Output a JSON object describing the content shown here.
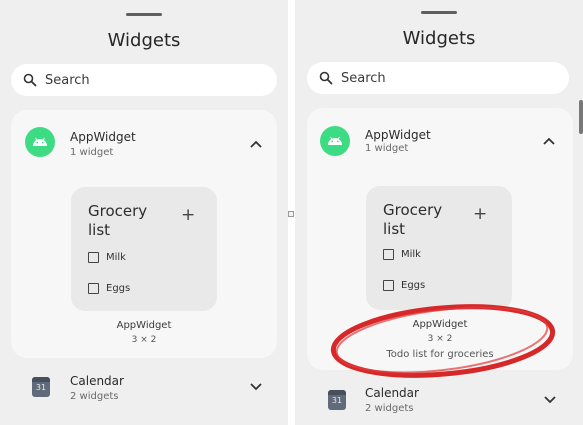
{
  "header": {
    "title": "Widgets"
  },
  "search": {
    "placeholder": "Search",
    "icon": "search-icon"
  },
  "app_widget": {
    "name": "AppWidget",
    "count": "1 widget",
    "icon_color": "#3ddc84"
  },
  "preview": {
    "title": "Grocery list",
    "add_symbol": "+",
    "items": [
      {
        "label": "Milk",
        "checked": false
      },
      {
        "label": "Eggs",
        "checked": false
      }
    ]
  },
  "widget_info": {
    "name": "AppWidget",
    "size": "3 × 2",
    "description": "Todo list for groceries"
  },
  "calendar": {
    "name": "Calendar",
    "count": "2 widgets",
    "icon_text": "31"
  },
  "annotation": {
    "color": "#d62828"
  }
}
